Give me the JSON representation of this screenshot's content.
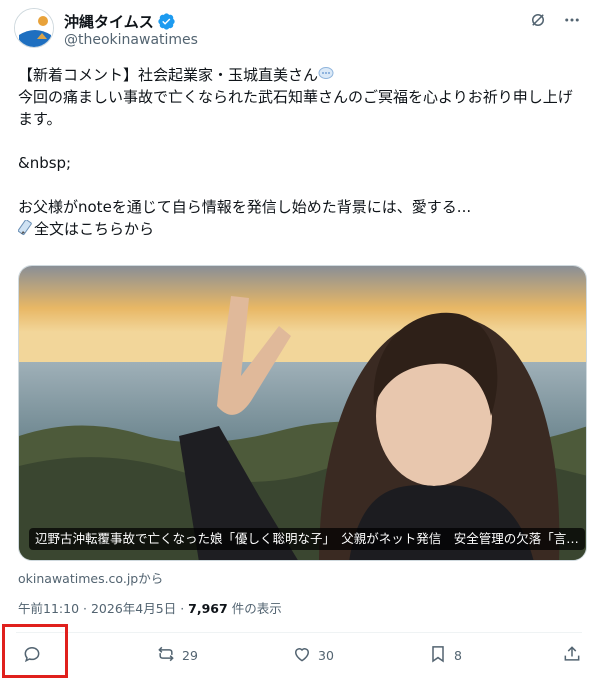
{
  "account": {
    "display_name": "沖縄タイムス",
    "handle": "@theokinawatimes",
    "avatar_text": "沖縄タイムス"
  },
  "tweet": {
    "line1": "【新着コメント】社会起業家・玉城直美さん",
    "line2": "今回の痛ましい事故で亡くなられた武石知華さんのご冥福を心よりお祈り申し上げます。",
    "line3": "&nbsp;",
    "line4": "お父様がnoteを通じて自ら情報を発信し始めた背景には、愛する...",
    "line5": "全文はこちらから"
  },
  "card": {
    "caption": "辺野古沖転覆事故で亡くなった娘「優しく聡明な子」　父親がネット発信　安全管理の欠落「言…",
    "domain": "okinawatimes.co.jpから"
  },
  "meta": {
    "time": "午前11:10",
    "sep1": "·",
    "date": "2026年4月5日",
    "sep2": "·",
    "views": "7,967",
    "views_label": "件の表示"
  },
  "actions": {
    "reply_count": "",
    "retweet_count": "29",
    "like_count": "30",
    "bookmark_count": "8"
  },
  "colors": {
    "text": "#0f1419",
    "secondary": "#536471",
    "verified": "#1d9bf0",
    "highlight": "#e0201d"
  },
  "icons": [
    "verified-badge-icon",
    "grok-icon",
    "more-icon",
    "speech-bubble-emoji",
    "memo-emoji",
    "reply-icon",
    "retweet-icon",
    "like-icon",
    "bookmark-icon",
    "share-icon"
  ]
}
